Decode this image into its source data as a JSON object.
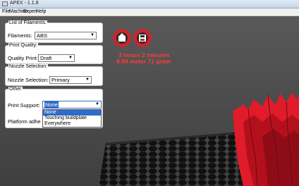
{
  "window": {
    "title": "APEX - 1.1.8"
  },
  "menu": [
    "File",
    "Machine",
    "Expert",
    "Help"
  ],
  "filaments": {
    "legend": "List of Filaments:",
    "label": "Filaments:",
    "value": "ABS"
  },
  "quality": {
    "legend": "Print Quality:",
    "label": "Quality Print:",
    "value": "Draft"
  },
  "nozzle": {
    "legend": "Nozzle Selection:",
    "label": "Nozzle Selection:",
    "value": "Primary"
  },
  "other": {
    "legend": "Other",
    "support_label": "Print Support:",
    "support_value": "None",
    "support_options": [
      "None",
      "Touching buildplate",
      "Everywhere"
    ],
    "adhesion_label": "Platform adhe"
  },
  "stats": {
    "time": "3 hours 2 minutes",
    "material": "8.98 meter 71 gram"
  },
  "icons": {
    "load": "load-model-icon",
    "save": "save-icon"
  },
  "colors": {
    "accent": "#c7262f",
    "stat_text": "#ff3b3b",
    "model": "#e01c2a"
  }
}
